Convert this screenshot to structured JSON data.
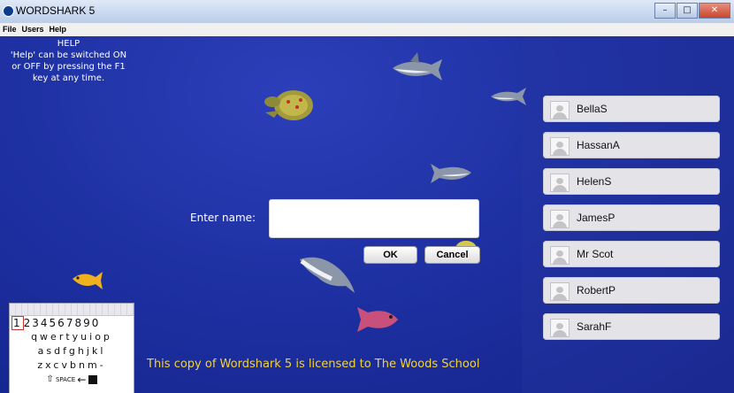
{
  "window": {
    "title": "WORDSHARK 5"
  },
  "menu": [
    "File",
    "Users",
    "Help"
  ],
  "help": {
    "heading": "HELP",
    "body": "'Help' can be switched ON or OFF by pressing the F1 key at any time."
  },
  "login": {
    "label": "Enter name:",
    "value": "",
    "ok_label": "OK",
    "cancel_label": "Cancel"
  },
  "users": [
    "BellaS",
    "HassanA",
    "HelenS",
    "JamesP",
    "Mr Scot",
    "RobertP",
    "SarahF"
  ],
  "keyboard": {
    "numbers": "1234567890",
    "row1": "qwertyuiop",
    "row2": "asdfghjkl",
    "row3": "zxcvbnm-",
    "space_label": "SPACE"
  },
  "license": "This copy of Wordshark 5 is licensed to The Woods School",
  "colors": {
    "background": "#1e31a3",
    "license_text": "#f4d432",
    "user_button": "#e4e4e8"
  },
  "icons": [
    "shark-icon",
    "turtle-icon",
    "fish-icon",
    "user-avatar-icon",
    "shift-icon",
    "backspace-icon",
    "enter-icon"
  ]
}
